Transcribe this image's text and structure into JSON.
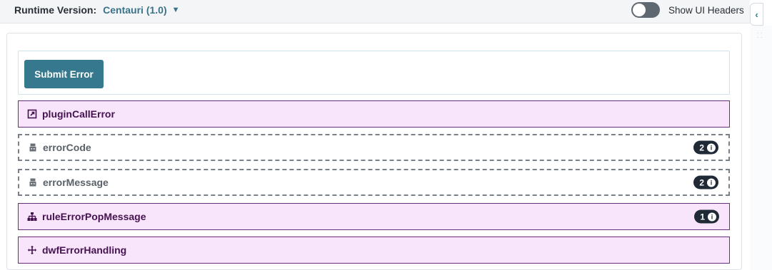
{
  "header": {
    "runtime_label": "Runtime Version:",
    "runtime_value": "Centauri (1.0)",
    "toggle_label": "Show UI Headers",
    "toggle_on": false
  },
  "submit": {
    "label": "Submit Error"
  },
  "rows": [
    {
      "label": "pluginCallError",
      "style": "solid",
      "icon": "external-link-icon"
    },
    {
      "label": "errorCode",
      "style": "dashed",
      "icon": "robot-icon",
      "badge": "2"
    },
    {
      "label": "errorMessage",
      "style": "dashed",
      "icon": "robot-icon",
      "badge": "2"
    },
    {
      "label": "ruleErrorPopMessage",
      "style": "solid",
      "icon": "sitemap-icon",
      "badge": "1"
    },
    {
      "label": "dwfErrorHandling",
      "style": "solid",
      "icon": "move-arrows-icon"
    }
  ],
  "colors": {
    "accent": "#36788d",
    "row_fill": "#f8e5fb",
    "row_border": "#6a2f79",
    "badge": "#1f2a36"
  }
}
